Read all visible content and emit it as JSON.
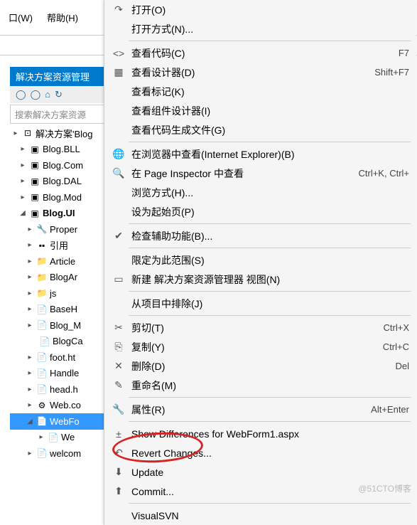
{
  "menubar": {
    "window": "口(W)",
    "help": "帮助(H)"
  },
  "panel": {
    "title": "解决方案资源管理",
    "search_ph": "搜索解决方案资源"
  },
  "tree": {
    "root": "解决方案'Blog",
    "p1": "Blog.BLL",
    "p2": "Blog.Com",
    "p3": "Blog.DAL",
    "p4": "Blog.Mod",
    "p5": "Blog.UI",
    "n1": "Proper",
    "n2": "引用",
    "n3": "Article",
    "n4": "BlogAr",
    "n5": "js",
    "n6": "BaseH",
    "n7": "Blog_M",
    "n8": "BlogCa",
    "n9": "foot.ht",
    "n10": "Handle",
    "n11": "head.h",
    "n12": "Web.co",
    "n13": "WebFo",
    "n14": "We",
    "n15": "welcom"
  },
  "ctx": {
    "i1": "打开(O)",
    "i2": "打开方式(N)...",
    "i3": "查看代码(C)",
    "i4": "查看设计器(D)",
    "i5": "查看标记(K)",
    "i6": "查看组件设计器(I)",
    "i7": "查看代码生成文件(G)",
    "i8": "在浏览器中查看(Internet Explorer)(B)",
    "i9": "在 Page Inspector 中查看",
    "i10": "浏览方式(H)...",
    "i11": "设为起始页(P)",
    "i12": "检查辅助功能(B)...",
    "i13": "限定为此范围(S)",
    "i14": "新建 解决方案资源管理器 视图(N)",
    "i15": "从项目中排除(J)",
    "i16": "剪切(T)",
    "i17": "复制(Y)",
    "i18": "删除(D)",
    "i19": "重命名(M)",
    "i20": "属性(R)",
    "i21": "Show Differences for WebForm1.aspx",
    "i22": "Revert Changes...",
    "i23": "Update",
    "i24": "Commit...",
    "i25": "VisualSVN"
  },
  "sc": {
    "s3": "F7",
    "s4": "Shift+F7",
    "s9": "Ctrl+K, Ctrl+",
    "s16": "Ctrl+X",
    "s17": "Ctrl+C",
    "s18": "Del",
    "s20": "Alt+Enter"
  },
  "watermark": "@51CTO博客"
}
